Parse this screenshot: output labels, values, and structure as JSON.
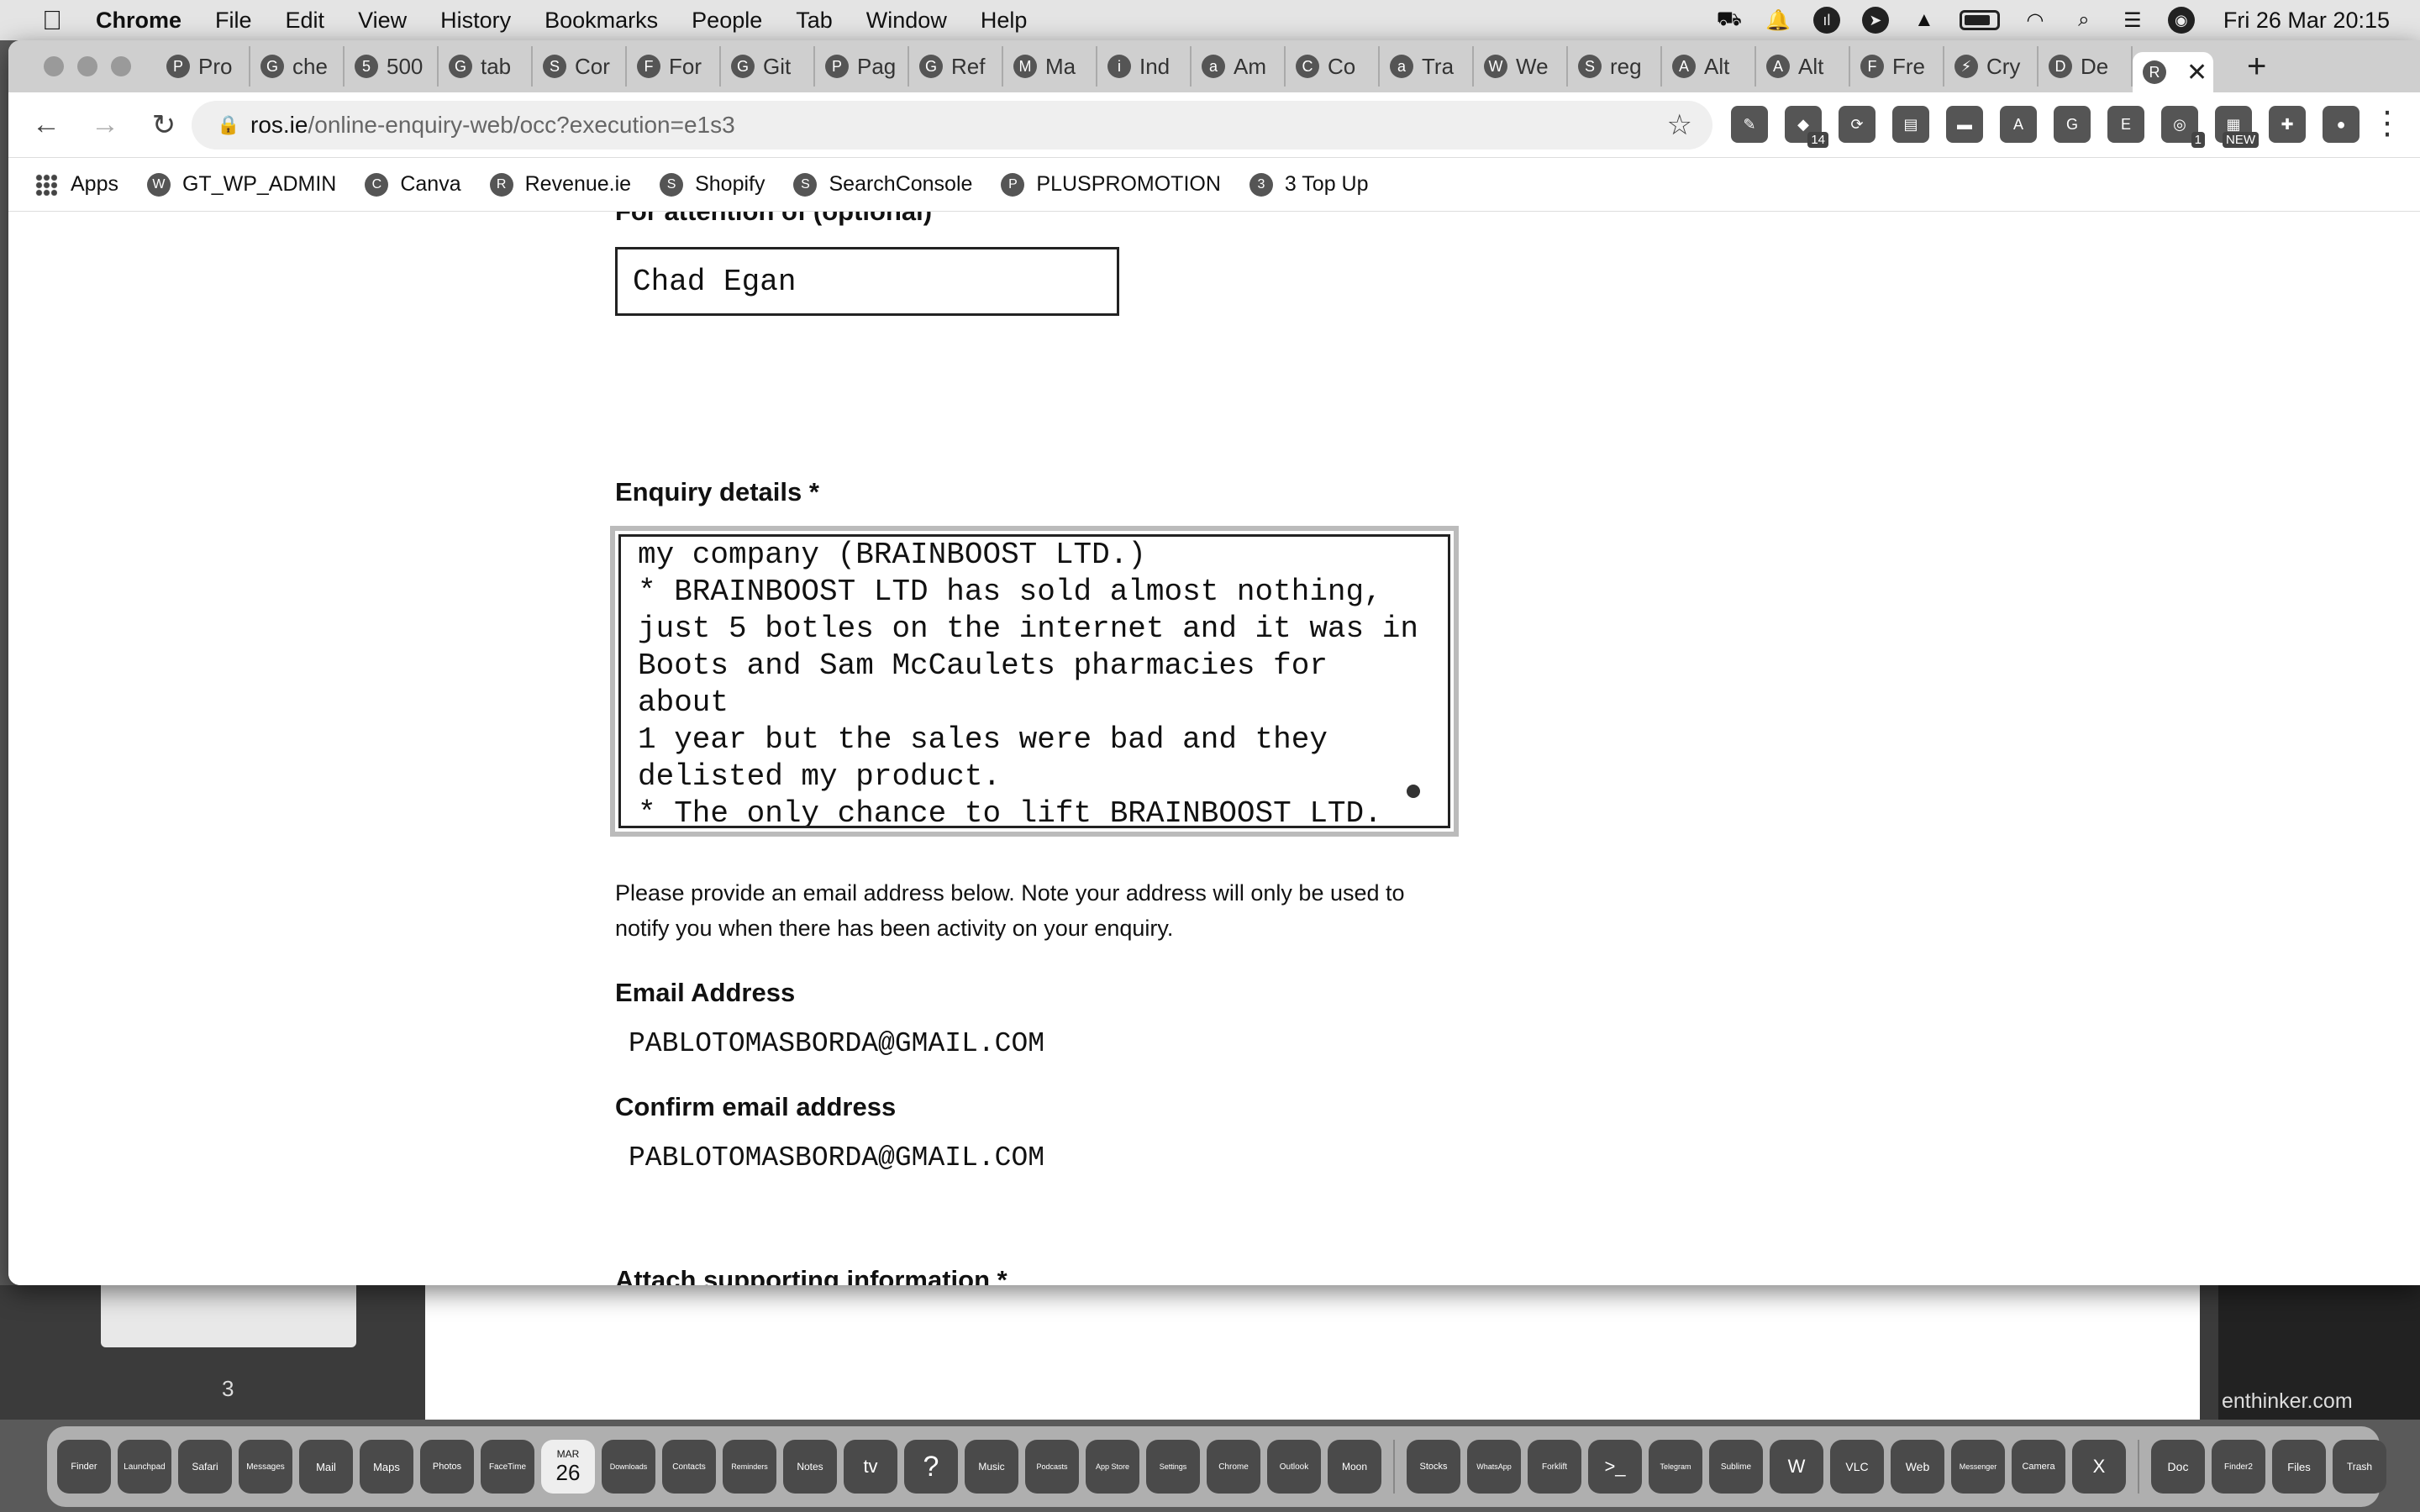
{
  "menubar": {
    "app": "Chrome",
    "items": [
      "File",
      "Edit",
      "View",
      "History",
      "Bookmarks",
      "People",
      "Tab",
      "Window",
      "Help"
    ],
    "clock": "Fri 26 Mar  20:15"
  },
  "tabs": [
    {
      "label": "Pro",
      "icon": "P"
    },
    {
      "label": "che",
      "icon": "G"
    },
    {
      "label": "500",
      "icon": "5"
    },
    {
      "label": "tab",
      "icon": "G"
    },
    {
      "label": "Cor",
      "icon": "S"
    },
    {
      "label": "For",
      "icon": "F"
    },
    {
      "label": "Git",
      "icon": "G"
    },
    {
      "label": "Pag",
      "icon": "P"
    },
    {
      "label": "Ref",
      "icon": "G"
    },
    {
      "label": "Ma",
      "icon": "M"
    },
    {
      "label": "Ind",
      "icon": "i"
    },
    {
      "label": "Am",
      "icon": "a"
    },
    {
      "label": "Co",
      "icon": "C"
    },
    {
      "label": "Tra",
      "icon": "a"
    },
    {
      "label": "We",
      "icon": "W"
    },
    {
      "label": "reg",
      "icon": "S"
    },
    {
      "label": "Alt",
      "icon": "A"
    },
    {
      "label": "Alt",
      "icon": "A"
    },
    {
      "label": "Fre",
      "icon": "F"
    },
    {
      "label": "Cry",
      "icon": "⚡"
    },
    {
      "label": "De",
      "icon": "D"
    }
  ],
  "active_tab": {
    "icon": "R",
    "close": "✕"
  },
  "new_tab": "+",
  "omnibox": {
    "host": "ros.ie",
    "path": "/online-enquiry-web/occ?execution=e1s3"
  },
  "extensions": [
    {
      "icon": "✎",
      "badge": ""
    },
    {
      "icon": "◆",
      "badge": "14"
    },
    {
      "icon": "⟳",
      "badge": ""
    },
    {
      "icon": "▤",
      "badge": ""
    },
    {
      "icon": "▬",
      "badge": ""
    },
    {
      "icon": "A",
      "badge": ""
    },
    {
      "icon": "G",
      "badge": ""
    },
    {
      "icon": "E",
      "badge": ""
    },
    {
      "icon": "◎",
      "badge": "1"
    },
    {
      "icon": "▦",
      "badge": "NEW"
    },
    {
      "icon": "✚",
      "badge": ""
    },
    {
      "icon": "●",
      "badge": ""
    }
  ],
  "bookmarks": [
    {
      "label": "Apps",
      "icon": "grid"
    },
    {
      "label": "GT_WP_ADMIN",
      "icon": "W"
    },
    {
      "label": "Canva",
      "icon": "C"
    },
    {
      "label": "Revenue.ie",
      "icon": "R"
    },
    {
      "label": "Shopify",
      "icon": "S"
    },
    {
      "label": "SearchConsole",
      "icon": "S"
    },
    {
      "label": "PLUSPROMOTION",
      "icon": "P"
    },
    {
      "label": "3 Top Up",
      "icon": "3"
    }
  ],
  "form": {
    "attention_label": "For attention of (optional)",
    "attention_value": "Chad Egan",
    "enquiry_label": "Enquiry details *",
    "enquiry_text": "my company (BRAINBOOST LTD.)\n* BRAINBOOST LTD has sold almost nothing,\njust 5 botles on the internet and it was in\nBoots and Sam McCaulets pharmacies for about\n1 year but the sales were bad and they\ndelisted my product.\n* The only chance to lift BRAINBOOST LTD.\nand be able to selll",
    "help_text": "Please provide an email address below. Note your address will only be used to notify you when there has been activity on your enquiry.",
    "email_label": "Email Address",
    "email_value": "PABLOTOMASBORDA@GMAIL.COM",
    "confirm_label": "Confirm email address",
    "confirm_value": "PABLOTOMASBORDA@GMAIL.COM",
    "attach_label": "Attach supporting information *"
  },
  "background": {
    "page_number": "3",
    "right_text": "enthinker.com"
  },
  "dock": {
    "calendar_day": "26",
    "calendar_month": "MAR",
    "items": [
      "Finder",
      "Launchpad",
      "Safari",
      "Messages",
      "Mail",
      "Maps",
      "Photos",
      "FaceTime",
      "Calendar",
      "Downloads",
      "Contacts",
      "Reminders",
      "Notes",
      "tv",
      "?",
      "Music",
      "Podcasts",
      "App Store",
      "Settings",
      "Chrome",
      "Outlook",
      "Moon",
      "Stocks",
      "WhatsApp",
      "Forklift",
      ">_",
      "Telegram",
      "Sublime",
      "W",
      "VLC",
      "Web",
      "Messenger",
      "Camera",
      "X",
      "Doc",
      "Finder2",
      "Files",
      "Trash"
    ]
  }
}
